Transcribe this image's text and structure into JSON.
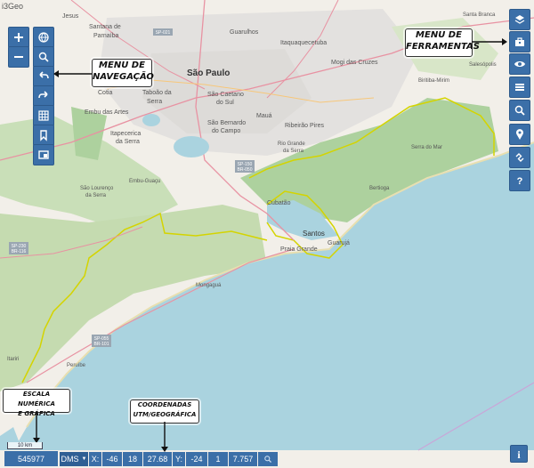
{
  "app": {
    "brand": "i3Geo"
  },
  "callouts": {
    "nav_menu": [
      "MENU DE",
      "NAVEGAÇÃO"
    ],
    "tools_menu": [
      "MENU DE",
      "FERRAMENTAS"
    ],
    "scale": [
      "ESCALA NUMÉRICA",
      "E GRÁFICA"
    ],
    "coords": [
      "COORDENADAS",
      "UTM/GEOGRÁFICA"
    ]
  },
  "nav_toolbar": [
    {
      "icon": "zoom-in-icon"
    },
    {
      "icon": "globe-icon"
    },
    {
      "icon": "zoom-out-icon"
    },
    {
      "icon": "zoom-box-icon"
    },
    {
      "icon": "undo-icon"
    },
    {
      "icon": "redo-icon"
    },
    {
      "icon": "grid-icon"
    },
    {
      "icon": "bookmark-icon"
    },
    {
      "icon": "window-icon"
    }
  ],
  "tools_toolbar": [
    {
      "icon": "layers-icon"
    },
    {
      "icon": "toolbox-icon"
    },
    {
      "icon": "eye-icon"
    },
    {
      "icon": "list-icon"
    },
    {
      "icon": "search-icon"
    },
    {
      "icon": "map-pin-icon"
    },
    {
      "icon": "link-icon"
    },
    {
      "icon": "help-icon"
    }
  ],
  "scale": {
    "numeric": "545977",
    "bar_label": "10 km"
  },
  "coords": {
    "format": "DMS",
    "x_label": "X:",
    "x_deg": "-46",
    "x_min": "18",
    "x_sec": "27.68",
    "y_label": "Y:",
    "y_deg": "-24",
    "y_min": "1",
    "y_sec": "7.757"
  },
  "map_labels": {
    "santana": "Santana de",
    "parnaiba": "Parnaíba",
    "guarulhos": "Guarulhos",
    "itaquaquecetuba": "Itaquaquecetuba",
    "sao_paulo": "São Paulo",
    "mogi": "Mogi das Cruzes",
    "cotia": "Cotia",
    "taboao": "Taboão da",
    "taboao2": "Serra",
    "sao_caetano": "São Caetano",
    "sao_caetano2": "do Sul",
    "embu": "Embu das Artes",
    "sao_bernardo": "São Bernardo",
    "sao_bernardo2": "do Campo",
    "maua": "Mauá",
    "ribeirao": "Ribeirão Pires",
    "rio_grande": "Rio Grande",
    "rio_grande2": "da Serra",
    "itapecerica": "Itapecerica",
    "itapecerica2": "da Serra",
    "embu_guacu": "Embu-Guaçu",
    "sao_lourenco": "São Lourenço",
    "sao_lourenco2": "da Serra",
    "serra_mar": "Serra do Mar",
    "cubatao": "Cubatão",
    "santos": "Santos",
    "guaruja": "Guarujá",
    "bertioga": "Bertioga",
    "praia_grande": "Praia Grande",
    "mongagua": "Mongaguá",
    "itanhaem": "Itanhaém",
    "peruibe": "Peruíbe",
    "itariri": "Itariri",
    "salesopolis": "Salesópolis",
    "santa_branca": "Santa Branca",
    "jesus": "Jesus",
    "biritiba": "Biritiba-Mirim",
    "sp021": "SP-021",
    "sp150": "SP-150",
    "br050": "BR-050",
    "sp230": "SP-230",
    "br116": "BR-116",
    "sp055": "SP-055",
    "br101": "BR-101"
  },
  "colors": {
    "button": "#3b6fa8",
    "sea": "#aad3df",
    "forest": "#add19e",
    "land": "#f2efe9",
    "urban": "#e0dfdf",
    "boundary": "#d4d400",
    "road": "#e892a2"
  }
}
